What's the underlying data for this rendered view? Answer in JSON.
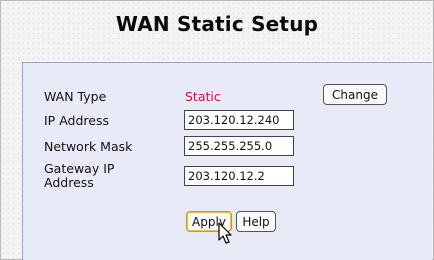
{
  "page": {
    "title": "WAN Static Setup"
  },
  "form": {
    "wan_type_label": "WAN Type",
    "wan_type_value": "Static",
    "ip_label": "IP Address",
    "ip_value": "203.120.12.240",
    "mask_label": "Network Mask",
    "mask_value": "255.255.255.0",
    "gateway_label_line1": "Gateway IP",
    "gateway_label_line2": "Address",
    "gateway_value": "203.120.12.2"
  },
  "buttons": {
    "change": "Change",
    "apply": "Apply",
    "help": "Help"
  },
  "colors": {
    "panel_bg": "#e9eaf7",
    "static_value": "#c8103e"
  },
  "icons": {
    "cursor": "mouse-pointer-icon"
  }
}
